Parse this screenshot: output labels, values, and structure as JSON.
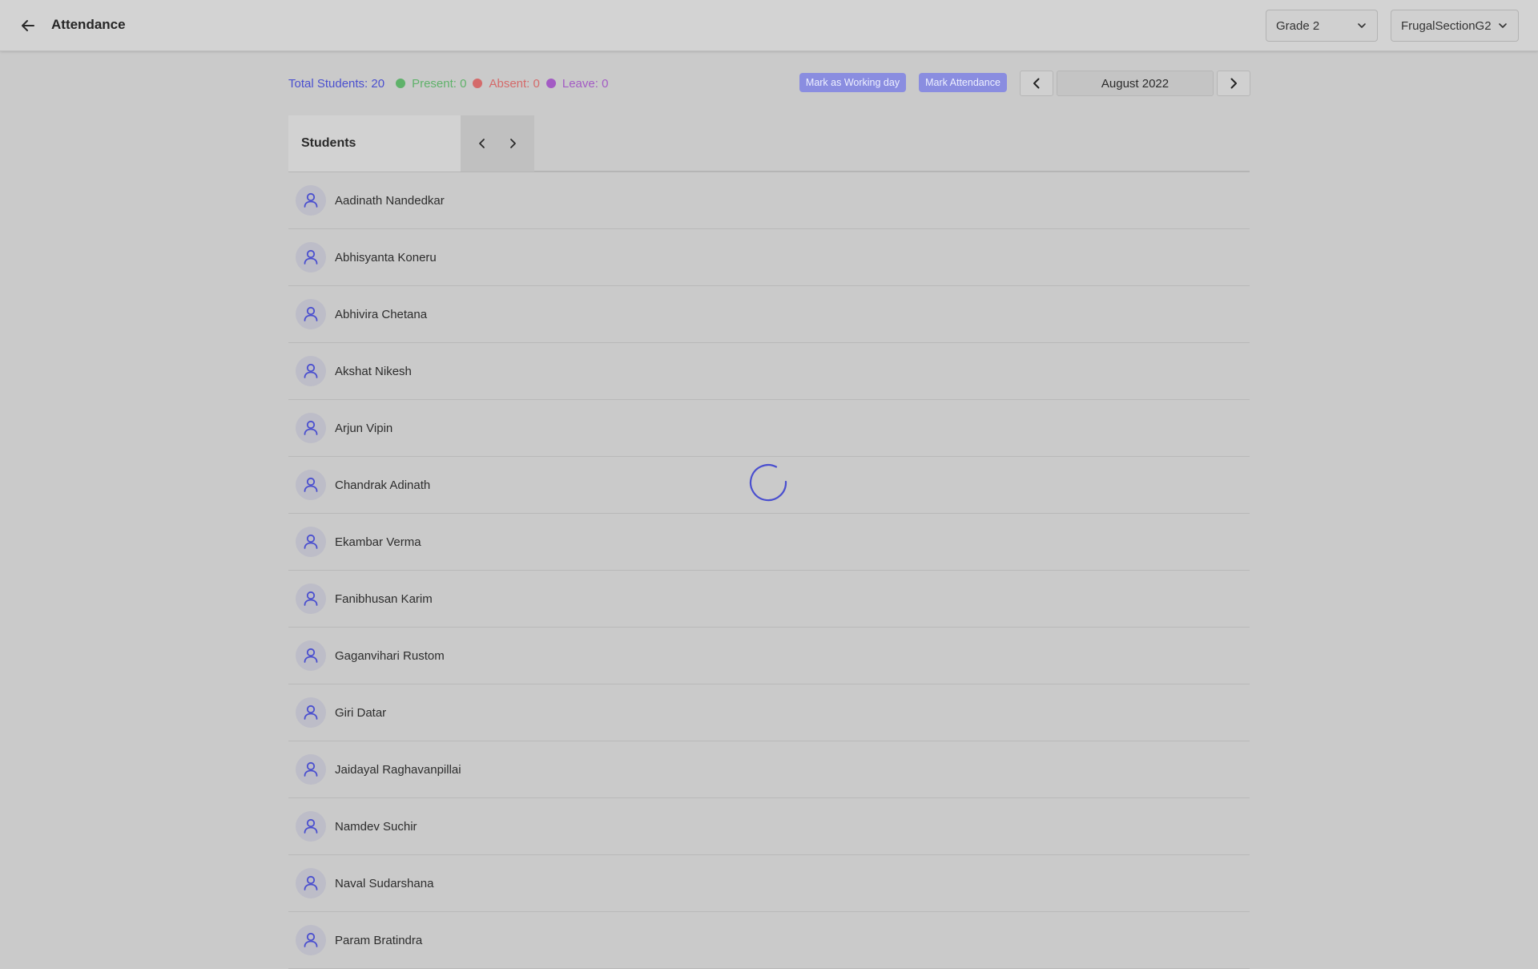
{
  "header": {
    "title": "Attendance",
    "grade": "Grade 2",
    "section": "FrugalSectionG2"
  },
  "summary": {
    "total": "Total Students: 20",
    "present": "Present: 0",
    "absent": "Absent: 0",
    "leave": "Leave: 0"
  },
  "actions": {
    "mark_working_day": "Mark as Working day",
    "mark_attendance": "Mark Attendance"
  },
  "month": "August 2022",
  "table": {
    "students_header": "Students"
  },
  "students": [
    "Aadinath Nandedkar",
    "Abhisyanta Koneru",
    "Abhivira Chetana",
    "Akshat Nikesh",
    "Arjun Vipin",
    "Chandrak Adinath",
    "Ekambar Verma",
    "Fanibhusan Karim",
    "Gaganvihari Rustom",
    "Giri Datar",
    "Jaidayal Raghavanpillai",
    "Namdev Suchir",
    "Naval Sudarshana",
    "Param Bratindra"
  ],
  "colors": {
    "accent": "#4a4fcf",
    "present": "#5fb26a",
    "absent": "#d46a6a",
    "leave": "#a35bc4",
    "pill": "#8a8de0"
  },
  "icons": {
    "back": "arrow-left-icon",
    "dropdown": "chevron-down-icon",
    "prev": "chevron-left-icon",
    "next": "chevron-right-icon",
    "avatar": "user-icon",
    "loading": "spinner-icon"
  }
}
